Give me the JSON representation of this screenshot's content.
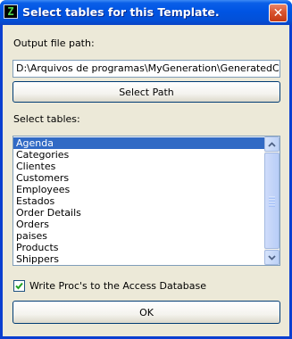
{
  "window": {
    "title": "Select tables for this Template.",
    "close_symbol": "✕",
    "app_icon_glyph": "Z"
  },
  "output": {
    "label": "Output file path:",
    "path_value": "D:\\Arquivos de programas\\MyGeneration\\GeneratedCode\\",
    "select_path_label": "Select Path"
  },
  "tables": {
    "label": "Select tables:",
    "items": [
      {
        "label": "Agenda",
        "selected": true
      },
      {
        "label": "Categories",
        "selected": false
      },
      {
        "label": "Clientes",
        "selected": false
      },
      {
        "label": "Customers",
        "selected": false
      },
      {
        "label": "Employees",
        "selected": false
      },
      {
        "label": "Estados",
        "selected": false
      },
      {
        "label": "Order Details",
        "selected": false
      },
      {
        "label": "Orders",
        "selected": false
      },
      {
        "label": "paises",
        "selected": false
      },
      {
        "label": "Products",
        "selected": false
      },
      {
        "label": "Shippers",
        "selected": false
      }
    ]
  },
  "options": {
    "write_procs_label": "Write Proc's to the Access Database",
    "write_procs_checked": true
  },
  "actions": {
    "ok_label": "OK"
  },
  "icons": {
    "app": "app-icon",
    "close": "close-icon",
    "scroll_up": "chevron-up-icon",
    "scroll_down": "chevron-down-icon",
    "check": "checkmark-icon"
  },
  "colors": {
    "titlebar": "#0054e3",
    "selection": "#316ac5",
    "dialog_bg": "#ece9d8",
    "close_button": "#d9542f"
  }
}
